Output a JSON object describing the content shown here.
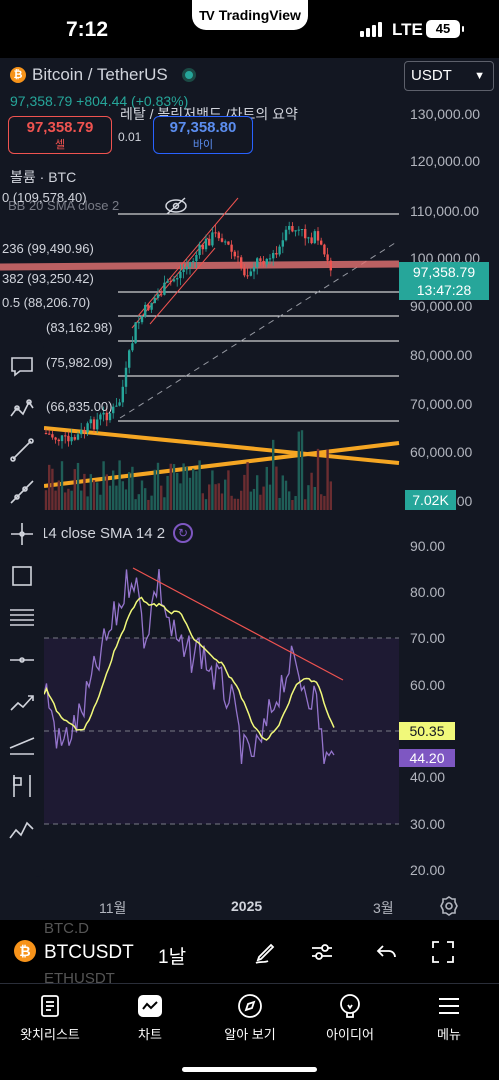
{
  "status": {
    "time": "7:12",
    "brand": "TradingView",
    "network": "LTE",
    "battery": "45"
  },
  "header": {
    "title": "Bitcoin / TetherUS",
    "coin_glyph": "₿",
    "price_line": "97,358.79 +804.44 (+0.83%)",
    "sell_price": "97,358.79",
    "sell_label": "셀",
    "spread": "0.01",
    "buy_price": "97,358.80",
    "buy_label": "바이",
    "overlay_text": "레탈 / 볼린저밴드 /차트의 요약",
    "volume_label": "볼륨 · BTC",
    "bb_label": "BB 20 SMA close 2",
    "currency_select": "USDT"
  },
  "fib_labels": [
    "0 (109,578.40)",
    "236 (99,490.96)",
    "382 (93,250.42)",
    "0.5 (88,206.70)",
    "(83,162.98)",
    "(75,982.09)",
    "(66,835.00)"
  ],
  "price_axis": [
    "130,000.00",
    "120,000.00",
    "110,000.00",
    "100,000.00",
    "90,000.00",
    "80,000.00",
    "70,000.00",
    "60,000.00",
    "50,000.00"
  ],
  "price_tag": {
    "price": "97,358.79",
    "countdown": "13:47:28"
  },
  "volume_tag": "7.02K",
  "rsi": {
    "label": "14 close SMA 14 2",
    "axis": [
      "90.00",
      "80.00",
      "70.00",
      "60.00",
      "50.00",
      "40.00",
      "30.00",
      "20.00"
    ],
    "sma_tag": "50.35",
    "rsi_tag": "44.20"
  },
  "time_axis": [
    "11월",
    "2025",
    "3월"
  ],
  "symbol_bar": {
    "symbol": "BTCUSDT",
    "interval": "1날",
    "ghost1": "BTC.D",
    "ghost2": "ETHUSDT"
  },
  "nav": [
    {
      "label": "왓치리스트",
      "icon": "watchlist-icon"
    },
    {
      "label": "차트",
      "icon": "chart-icon"
    },
    {
      "label": "알아 보기",
      "icon": "explore-icon"
    },
    {
      "label": "아이디어",
      "icon": "ideas-icon"
    },
    {
      "label": "메뉴",
      "icon": "menu-icon"
    }
  ],
  "colors": {
    "up": "#26a69a",
    "down": "#ef5350",
    "background": "#131722",
    "fib": "#ffffff",
    "trend_orange": "#f5a623",
    "resistance": "#f06292",
    "rsi": "#9575cd",
    "rsi_sma": "#f1f97a"
  }
}
